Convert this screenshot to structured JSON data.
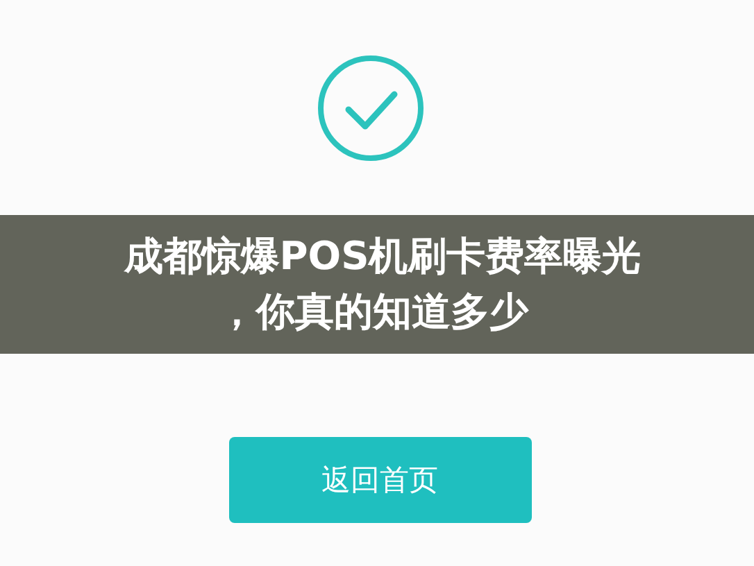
{
  "overlay_title": {
    "lines": [
      "成都惊爆POS机刷卡费率曝光",
      "，你真的知道多少"
    ]
  },
  "button": {
    "label": "返回首页"
  }
}
